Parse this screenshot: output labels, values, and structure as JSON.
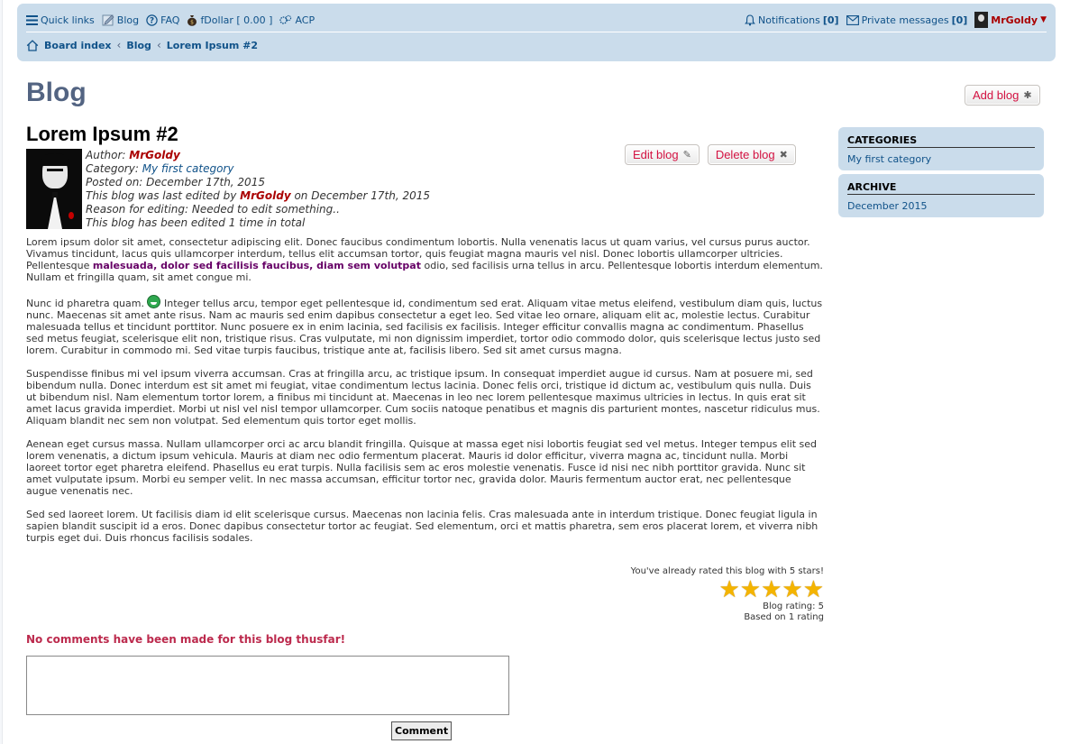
{
  "nav": {
    "quick_links": "Quick links",
    "blog": "Blog",
    "faq": "FAQ",
    "fdollar": "fDollar [ 0.00 ]",
    "acp": "ACP",
    "notifications": "Notifications",
    "notifications_count": "[0]",
    "private_messages": "Private messages",
    "pm_count": "[0]",
    "username": "MrGoldy"
  },
  "breadcrumbs": [
    "Board index",
    "Blog",
    "Lorem Ipsum #2"
  ],
  "page": {
    "title": "Blog",
    "add_blog_label": "Add blog"
  },
  "blog": {
    "title": "Lorem Ipsum #2",
    "edit_label": "Edit blog",
    "delete_label": "Delete blog",
    "author_label": "Author:",
    "author": "MrGoldy",
    "category_label": "Category:",
    "category": "My first category",
    "posted_label": "Posted on:",
    "posted_date": "December 17th, 2015",
    "edited_prefix": "This blog was last edited by",
    "edited_by": "MrGoldy",
    "edited_suffix": "on December 17th, 2015",
    "reason": "Reason for editing: Needed to edit something..",
    "edit_count": "This blog has been edited 1 time in total",
    "p1_before": "Lorem ipsum dolor sit amet, consectetur adipiscing elit. Donec faucibus condimentum lobortis. Nulla venenatis lacus ut quam varius, vel cursus purus auctor. Vivamus tincidunt, lacus quis ullamcorper interdum, tellus elit accumsan tortor, quis feugiat magna mauris vel nisl. Donec lobortis ullamcorper ultricies. Pellentesque",
    "p1_bold": "malesuada, dolor sed facilisis faucibus, diam sem volutpat",
    "p1_after": "odio, sed facilisis urna tellus in arcu. Pellentesque lobortis interdum elementum. Nullam et fringilla quam, sit amet congue mi.",
    "p2_before": "Nunc id pharetra quam.",
    "p2_after": "Integer tellus arcu, tempor eget pellentesque id, condimentum sed erat. Aliquam vitae metus eleifend, vestibulum diam quis, luctus nunc. Maecenas sit amet ante risus. Nam ac mauris sed enim dapibus consectetur a eget leo. Sed vitae leo ornare, aliquam elit ac, molestie lectus. Curabitur malesuada tellus et tincidunt porttitor. Nunc posuere ex in enim lacinia, sed facilisis ex facilisis. Integer efficitur convallis magna ac condimentum. Phasellus sed metus feugiat, scelerisque elit non, tristique risus. Cras vulputate, mi non dignissim imperdiet, tortor odio commodo dolor, quis scelerisque lectus justo sed lorem. Curabitur in commodo mi. Sed vitae turpis faucibus, tristique ante at, facilisis libero. Sed sit amet cursus magna.",
    "p3": "Suspendisse finibus mi vel ipsum viverra accumsan. Cras at fringilla arcu, ac tristique ipsum. In consequat imperdiet augue id cursus. Nam at posuere mi, sed bibendum nulla. Donec interdum est sit amet mi feugiat, vitae condimentum lectus lacinia. Donec felis orci, tristique id dictum ac, vestibulum quis nulla. Duis ut bibendum nisl. Nam elementum tortor lorem, a finibus mi tincidunt at. Maecenas in leo nec lorem pellentesque maximus ultricies in lectus. In quis erat sit amet lacus gravida imperdiet. Morbi ut nisl vel nisl tempor ullamcorper. Cum sociis natoque penatibus et magnis dis parturient montes, nascetur ridiculus mus. Aliquam blandit nec sem non volutpat. Sed elementum quis tortor eget mollis.",
    "p4": "Aenean eget cursus massa. Nullam ullamcorper orci ac arcu blandit fringilla. Quisque at massa eget nisi lobortis feugiat sed vel metus. Integer tempus elit sed lorem venenatis, a dictum ipsum vehicula. Mauris at diam nec odio fermentum placerat. Mauris id dolor efficitur, viverra magna ac, tincidunt nulla. Morbi laoreet tortor eget pharetra eleifend. Phasellus eu erat turpis. Nulla facilisis sem ac eros molestie venenatis. Fusce id nisi nec nibh porttitor gravida. Nunc sit amet vulputate ipsum. Morbi eu semper velit. In nec massa accumsan, efficitur tortor nec, gravida dolor. Mauris fermentum auctor erat, nec pellentesque augue venenatis nec.",
    "p5": "Sed sed laoreet lorem. Ut facilisis diam id elit scelerisque cursus. Maecenas non lacinia felis. Cras malesuada ante in interdum tristique. Donec feugiat ligula in sapien blandit suscipit id a eros. Donec dapibus consectetur tortor ac feugiat. Sed elementum, orci et mattis pharetra, sem eros placerat lorem, et viverra nibh turpis eget dui. Duis rhoncus facilisis sodales."
  },
  "rating": {
    "already_rated": "You've already rated this blog with 5 stars!",
    "stars": 5,
    "blog_rating": "Blog rating: 5",
    "based_on": "Based on 1 rating"
  },
  "comments": {
    "empty_message": "No comments have been made for this blog thusfar!",
    "textarea_value": "",
    "submit_label": "Comment"
  },
  "sidebar": {
    "categories_title": "CATEGORIES",
    "categories": [
      "My first category"
    ],
    "archive_title": "ARCHIVE",
    "archive": [
      "December 2015"
    ]
  },
  "colors": {
    "navbar_bg": "#cadceb",
    "link": "#105289",
    "username": "#aa0000",
    "button_text": "#d31141",
    "no_comments": "#bc2a4d",
    "star": "#f4b400"
  }
}
